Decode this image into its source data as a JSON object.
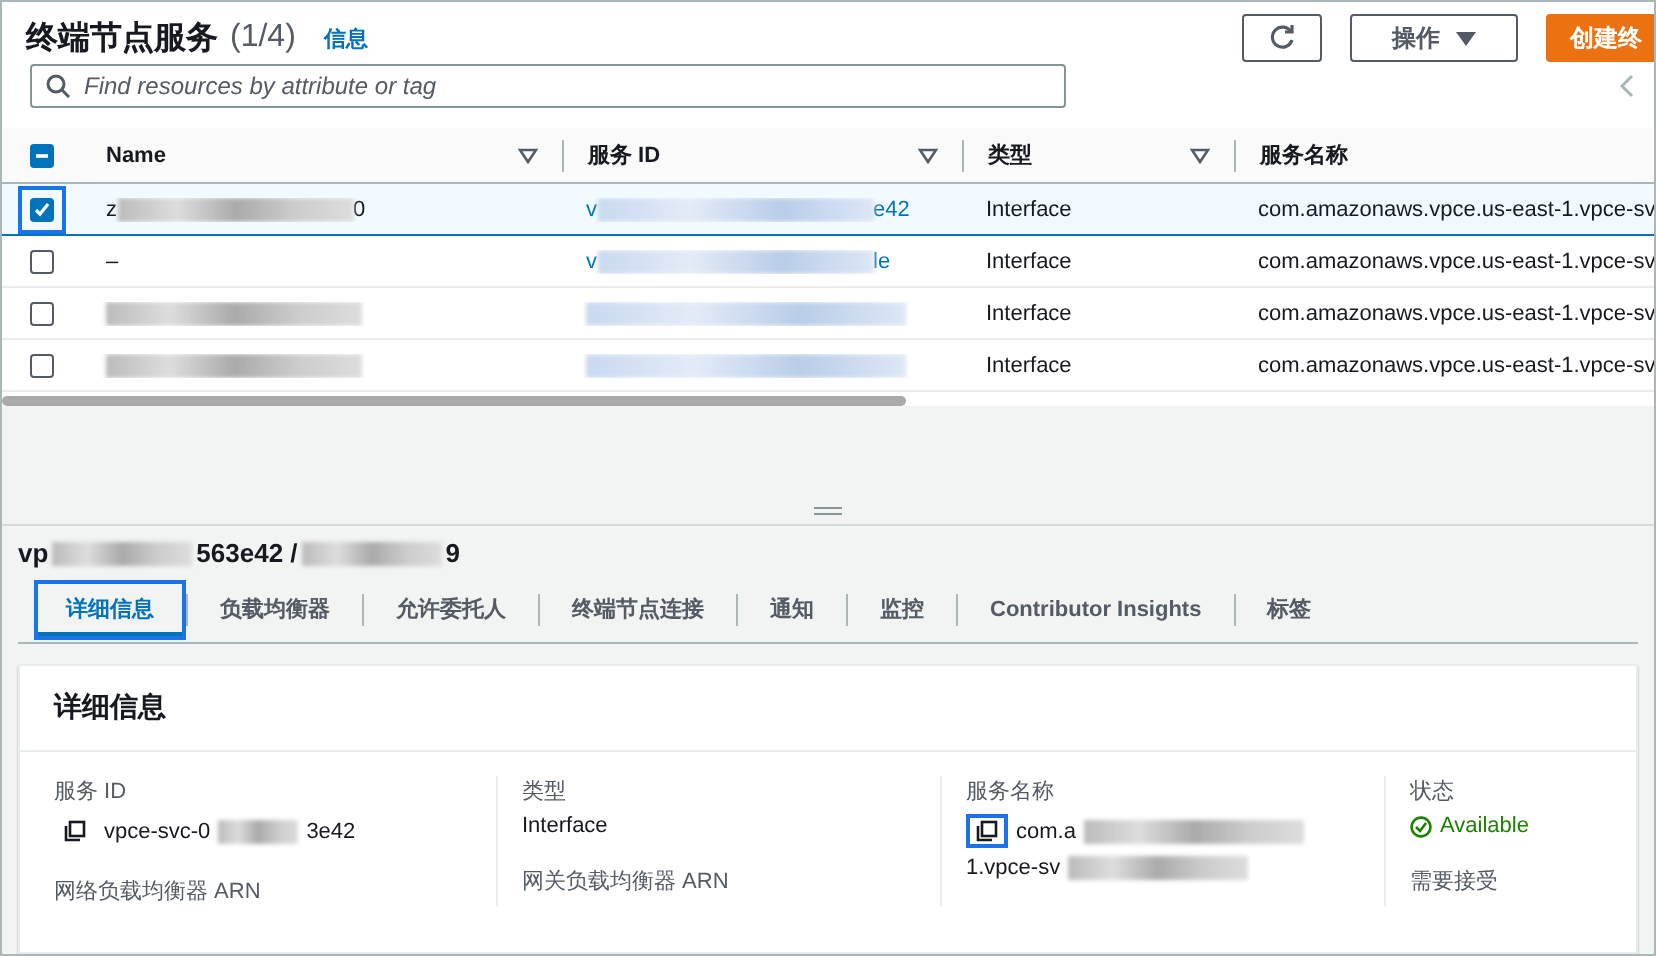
{
  "header": {
    "title": "终端节点服务",
    "count": "(1/4)",
    "info_link": "信息",
    "actions_label": "操作",
    "create_label": "创建终"
  },
  "search": {
    "placeholder": "Find resources by attribute or tag"
  },
  "table": {
    "select_all": {
      "indeterminate": true
    },
    "columns": [
      {
        "label": "Name",
        "filter": true
      },
      {
        "label": "服务 ID",
        "filter": true
      },
      {
        "label": "类型",
        "filter": true
      },
      {
        "label": "服务名称",
        "filter": false
      }
    ],
    "rows": [
      {
        "selected": true,
        "highlighted": true,
        "name": [
          {
            "kind": "text",
            "text": "z"
          },
          {
            "kind": "blur"
          },
          {
            "kind": "text",
            "text": "0"
          }
        ],
        "service_id": [
          {
            "kind": "text",
            "text": "v"
          },
          {
            "kind": "blur"
          },
          {
            "kind": "text",
            "text": "e42"
          }
        ],
        "type": "Interface",
        "service_name": "com.amazonaws.vpce.us-east-1.vpce-sv"
      },
      {
        "selected": false,
        "highlighted": false,
        "name": [
          {
            "kind": "text",
            "text": "–"
          }
        ],
        "service_id": [
          {
            "kind": "text",
            "text": "v"
          },
          {
            "kind": "blur"
          },
          {
            "kind": "text",
            "text": "le"
          }
        ],
        "type": "Interface",
        "service_name": "com.amazonaws.vpce.us-east-1.vpce-sv"
      },
      {
        "selected": false,
        "highlighted": false,
        "name": [
          {
            "kind": "blur"
          }
        ],
        "service_id": [
          {
            "kind": "blur"
          }
        ],
        "type": "Interface",
        "service_name": "com.amazonaws.vpce.us-east-1.vpce-sv"
      },
      {
        "selected": false,
        "highlighted": false,
        "name": [
          {
            "kind": "blur"
          }
        ],
        "service_id": [
          {
            "kind": "blur"
          }
        ],
        "type": "Interface",
        "service_name": "com.amazonaws.vpce.us-east-1.vpce-sv"
      }
    ]
  },
  "detail": {
    "title": [
      {
        "kind": "text",
        "text": "vp"
      },
      {
        "kind": "blur"
      },
      {
        "kind": "text",
        "text": "563e42 /"
      },
      {
        "kind": "blur"
      },
      {
        "kind": "text",
        "text": "9"
      }
    ],
    "tabs": [
      {
        "label": "详细信息",
        "selected": true,
        "highlighted": true
      },
      {
        "label": "负载均衡器",
        "selected": false,
        "highlighted": false
      },
      {
        "label": "允许委托人",
        "selected": false,
        "highlighted": false
      },
      {
        "label": "终端节点连接",
        "selected": false,
        "highlighted": false
      },
      {
        "label": "通知",
        "selected": false,
        "highlighted": false
      },
      {
        "label": "监控",
        "selected": false,
        "highlighted": false
      },
      {
        "label": "Contributor Insights",
        "selected": false,
        "highlighted": false
      },
      {
        "label": "标签",
        "selected": false,
        "highlighted": false
      }
    ],
    "card_title": "详细信息",
    "fields": [
      {
        "label": "服务 ID",
        "copy": {
          "highlighted": false
        },
        "value": [
          {
            "kind": "text",
            "text": "vpce-svc-0"
          },
          {
            "kind": "blur"
          },
          {
            "kind": "text",
            "text": "3e42"
          }
        ],
        "next_label": "网络负载均衡器 ARN"
      },
      {
        "label": "类型",
        "value": [
          {
            "kind": "text",
            "text": "Interface"
          }
        ],
        "next_label": "网关负载均衡器 ARN"
      },
      {
        "label": "服务名称",
        "copy": {
          "highlighted": true
        },
        "value": [
          {
            "kind": "text",
            "text": "com.a"
          },
          {
            "kind": "blur"
          }
        ],
        "value_line2": [
          {
            "kind": "text",
            "text": "1.vpce-sv"
          },
          {
            "kind": "blur"
          }
        ]
      },
      {
        "label": "状态",
        "status": "Available",
        "next_label": "需要接受"
      }
    ]
  }
}
